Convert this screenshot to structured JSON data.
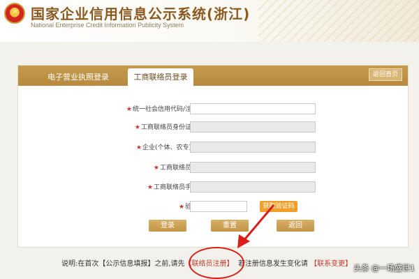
{
  "header": {
    "title_cn": "国家企业信用信息公示系统(浙江)",
    "title_en": "National Enterprise Credit Information Publicity System"
  },
  "tabs": {
    "inactive": "电子营业执照登录",
    "active": "工商联络员登录",
    "back_home": "返回首页"
  },
  "form": {
    "credit_code_label": "统一社会信用代码/注册号",
    "id_label": "工商联络员身份证号码",
    "enterprise_label": "企业(个体、农专)名称",
    "name_label": "工商联络员姓名",
    "phone_label": "工商联络员手机号",
    "captcha_label": "验证码",
    "captcha_button": "获取验证码",
    "credit_code_value": "",
    "id_value": "",
    "enterprise_value": "",
    "name_value": "",
    "phone_value": "",
    "captcha_value": ""
  },
  "buttons": {
    "login": "登录",
    "reset": "重置",
    "back": "返回"
  },
  "note": {
    "prefix": "说明:在首次【公示信息填报】之前,请先",
    "register_link": "【联络员注册】",
    "middle": "若注册信息发生变化请",
    "tail": "【联系变更】"
  },
  "watermark": "头条 @一场盛世1",
  "colors": {
    "accent": "#c69b4f",
    "required": "#d2322d",
    "captcha": "#f0a02a",
    "annotation": "#d91e18"
  }
}
